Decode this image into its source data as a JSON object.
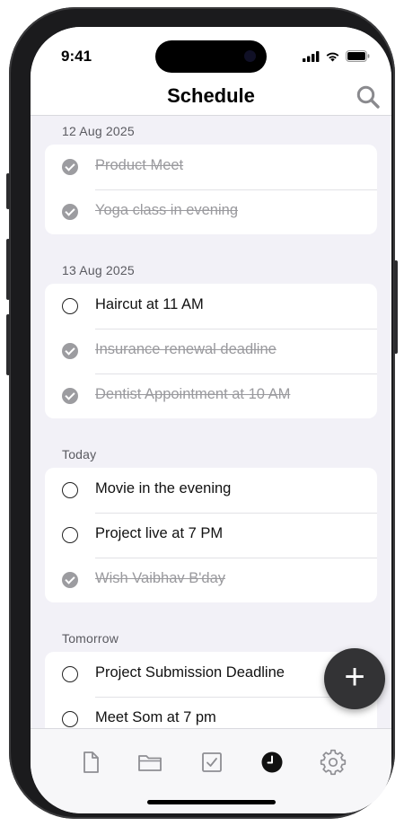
{
  "status": {
    "time": "9:41"
  },
  "header": {
    "title": "Schedule"
  },
  "icons": {
    "search": "search-icon",
    "add": "plus-icon",
    "tabs": [
      "document-icon",
      "folder-icon",
      "checkbox-icon",
      "clock-icon",
      "gear-icon"
    ]
  },
  "fab": {
    "label": "+"
  },
  "sections": [
    {
      "title": "12 Aug 2025",
      "items": [
        {
          "label": "Product Meet",
          "done": true
        },
        {
          "label": "Yoga class in evening",
          "done": true
        }
      ]
    },
    {
      "title": "13 Aug 2025",
      "items": [
        {
          "label": "Haircut at 11 AM",
          "done": false
        },
        {
          "label": "Insurance renewal deadline",
          "done": true
        },
        {
          "label": "Dentist Appointment at 10 AM",
          "done": true
        }
      ]
    },
    {
      "title": "Today",
      "items": [
        {
          "label": "Movie in the evening",
          "done": false
        },
        {
          "label": "Project live at 7 PM",
          "done": false
        },
        {
          "label": "Wish Vaibhav B'day",
          "done": true
        }
      ]
    },
    {
      "title": "Tomorrow",
      "items": [
        {
          "label": "Project Submission Deadline",
          "done": false
        },
        {
          "label": "Meet Som at 7 pm",
          "done": false
        }
      ]
    }
  ],
  "tabbar": {
    "active_index": 3
  },
  "colors": {
    "accent": "#333335",
    "background": "#f2f1f7",
    "done_text": "#9a9a9e"
  }
}
